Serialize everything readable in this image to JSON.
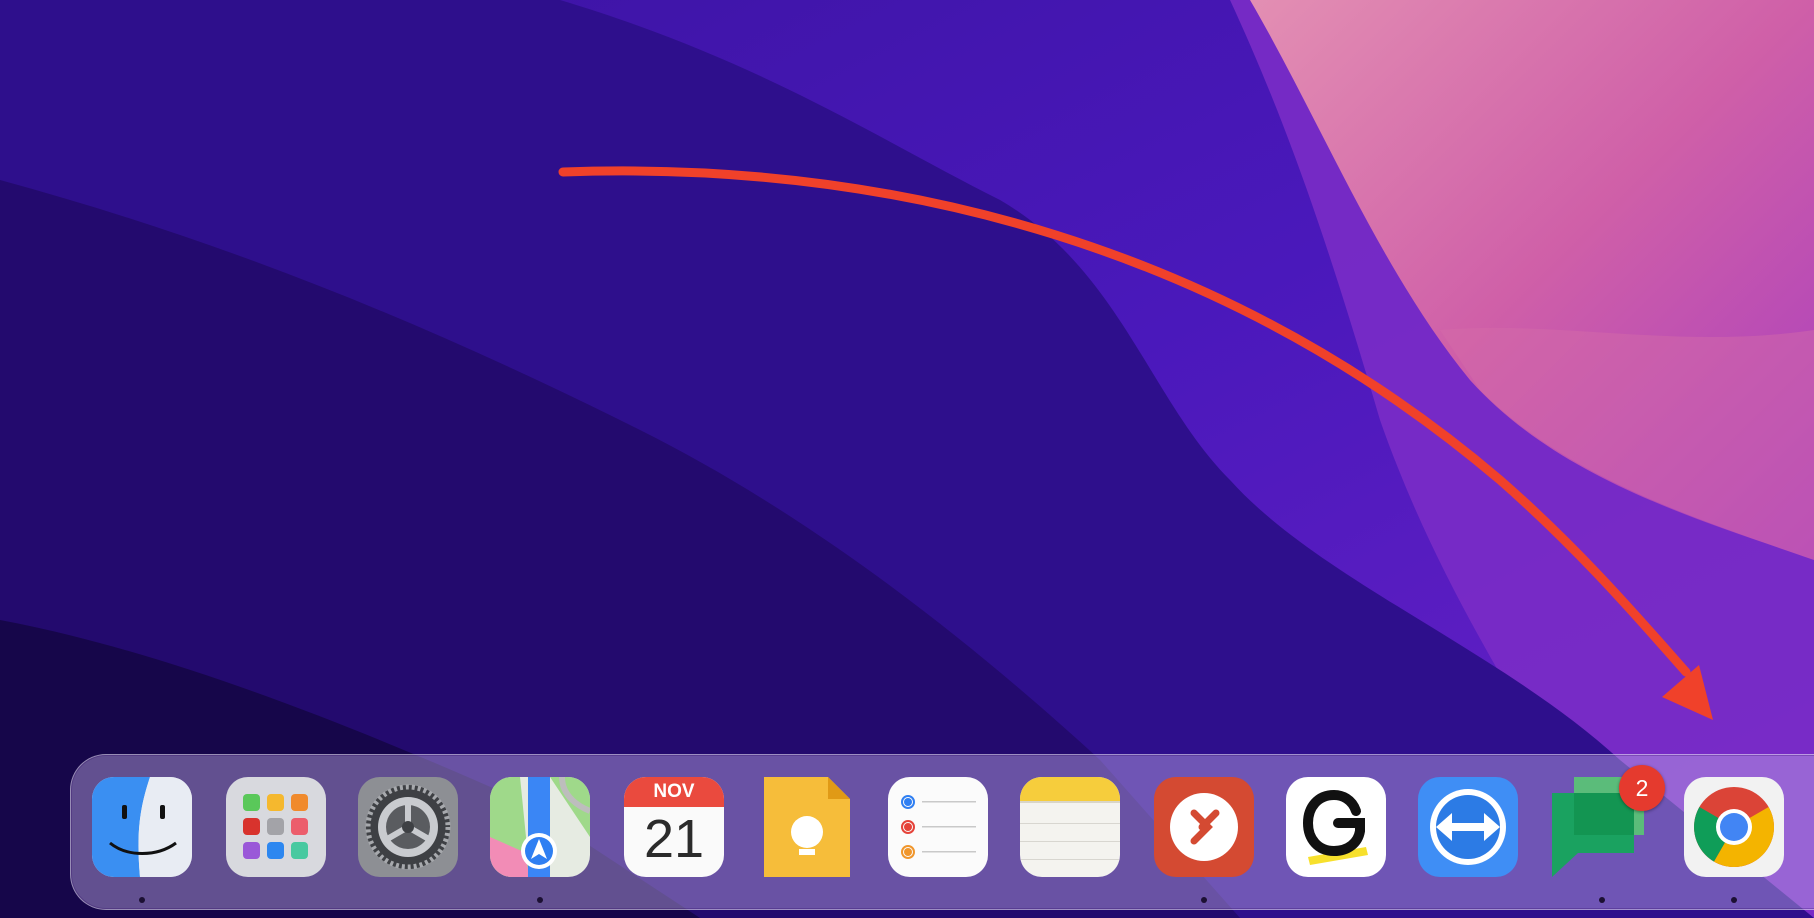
{
  "desktop": {
    "annotation": {
      "color": "#f0412a"
    }
  },
  "dock": {
    "apps": [
      {
        "icon": "finder-icon",
        "running": true
      },
      {
        "icon": "launchpad-icon",
        "running": false
      },
      {
        "icon": "system-preferences-icon",
        "running": false
      },
      {
        "icon": "maps-icon",
        "running": true
      },
      {
        "icon": "calendar-icon",
        "running": false,
        "month": "NOV",
        "day": "21"
      },
      {
        "icon": "keep-icon",
        "running": false
      },
      {
        "icon": "reminders-icon",
        "running": false
      },
      {
        "icon": "notes-icon",
        "running": false
      },
      {
        "icon": "remote-desktop-icon",
        "running": true
      },
      {
        "icon": "grammarly-icon",
        "running": false
      },
      {
        "icon": "teamviewer-icon",
        "running": false
      },
      {
        "icon": "google-chat-icon",
        "running": true,
        "badge": "2"
      },
      {
        "icon": "chrome-icon",
        "running": true
      }
    ]
  }
}
